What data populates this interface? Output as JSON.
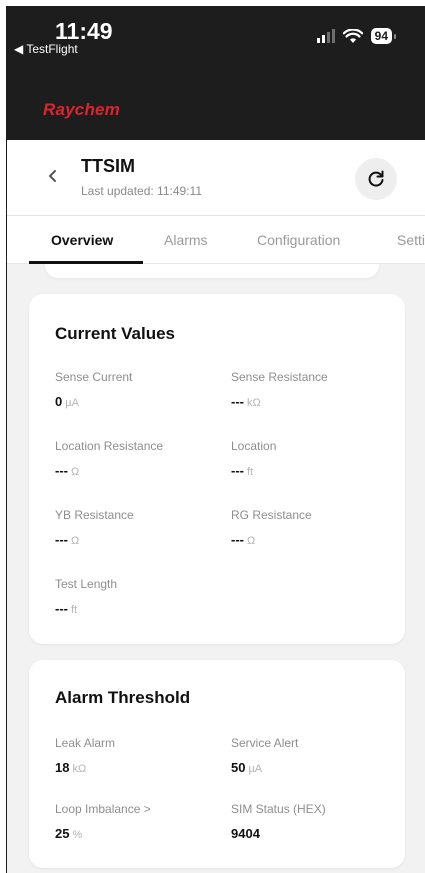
{
  "status_bar": {
    "time": "11:49",
    "back_app": "◀ TestFlight",
    "battery": "94"
  },
  "brand": {
    "name": "Raychem",
    "color": "#d8262f"
  },
  "header": {
    "title": "TTSIM",
    "last_updated": "Last updated: 11:49:11",
    "back_icon": "chevron-left-icon",
    "refresh_icon": "refresh-icon"
  },
  "tabs": [
    {
      "label": "Overview",
      "active": true
    },
    {
      "label": "Alarms",
      "active": false
    },
    {
      "label": "Configuration",
      "active": false
    },
    {
      "label": "Setti",
      "active": false
    }
  ],
  "current_values": {
    "title": "Current Values",
    "fields": [
      {
        "label": "Sense Current",
        "value": "0",
        "unit": "µA"
      },
      {
        "label": "Sense Resistance",
        "value": "---",
        "unit": "kΩ"
      },
      {
        "label": "Location Resistance",
        "value": "---",
        "unit": "Ω"
      },
      {
        "label": "Location",
        "value": "---",
        "unit": "ft"
      },
      {
        "label": "YB Resistance",
        "value": "---",
        "unit": "Ω"
      },
      {
        "label": "RG Resistance",
        "value": "---",
        "unit": "Ω"
      },
      {
        "label": "Test Length",
        "value": "---",
        "unit": "ft"
      }
    ]
  },
  "alarm_threshold": {
    "title": "Alarm Threshold",
    "fields": [
      {
        "label": "Leak Alarm",
        "value": "18",
        "unit": "kΩ"
      },
      {
        "label": "Service Alert",
        "value": "50",
        "unit": "µA"
      },
      {
        "label": "Loop Imbalance >",
        "value": "25",
        "unit": "%"
      },
      {
        "label": "SIM Status (HEX)",
        "value": "9404",
        "unit": ""
      }
    ]
  }
}
